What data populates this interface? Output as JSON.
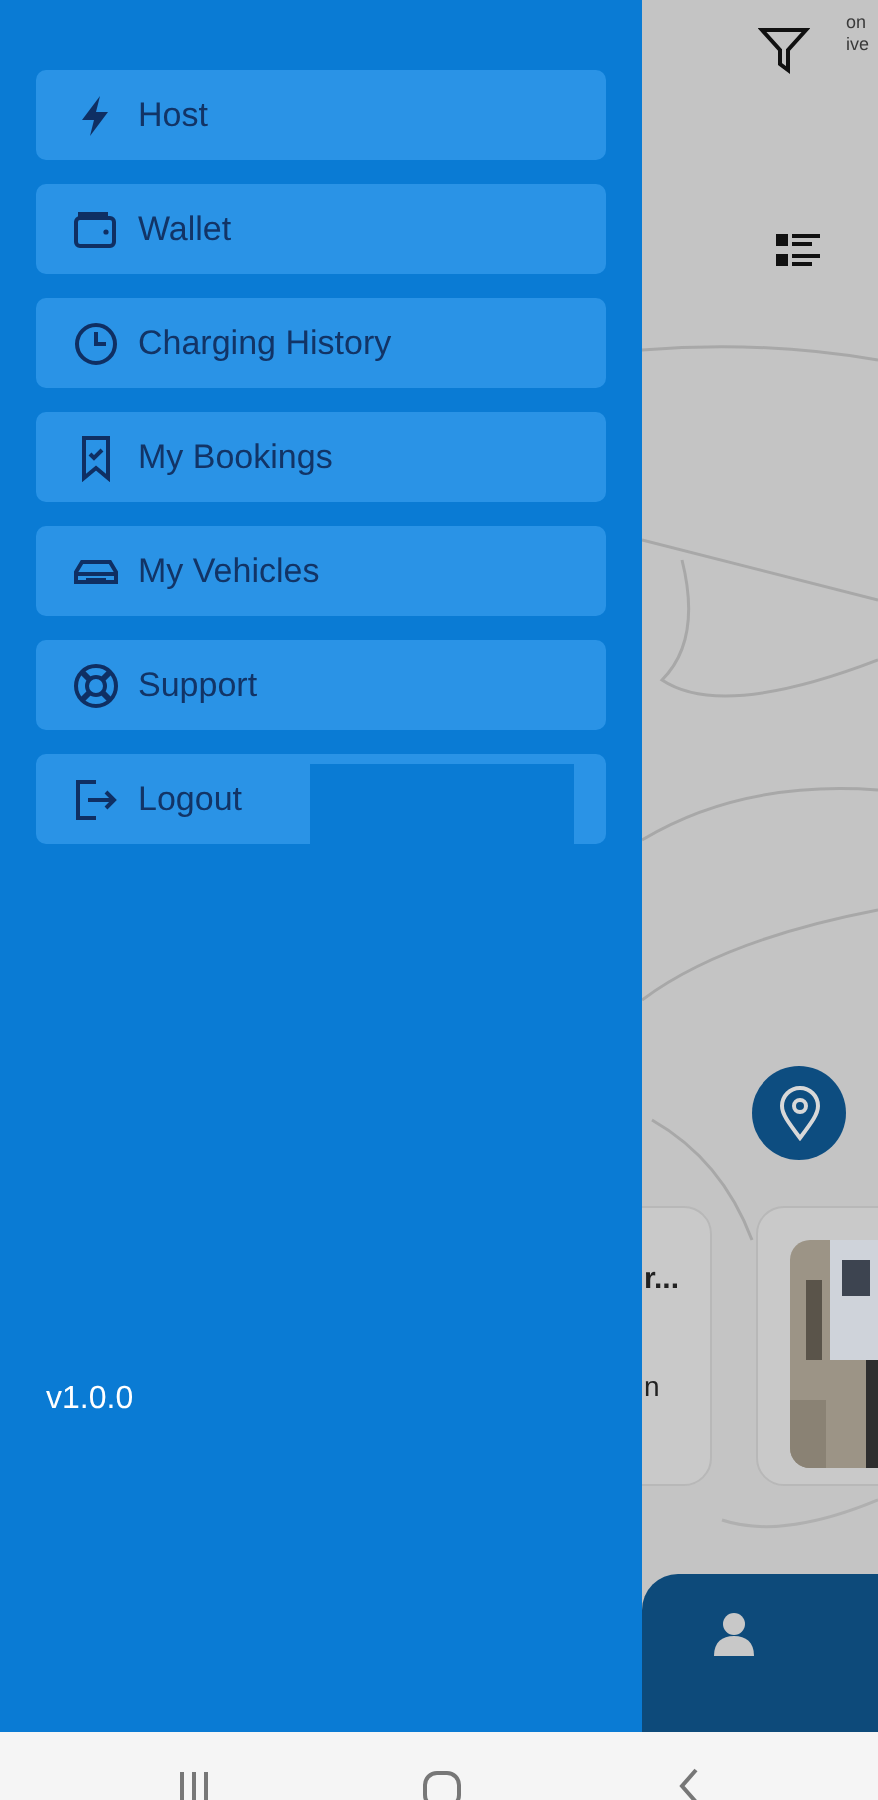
{
  "drawer": {
    "menu": [
      {
        "kind": "bolt",
        "label": "Host"
      },
      {
        "kind": "wallet",
        "label": "Wallet"
      },
      {
        "kind": "clock",
        "label": "Charging History"
      },
      {
        "kind": "bookmark",
        "label": "My Bookings"
      },
      {
        "kind": "car",
        "label": "My Vehicles"
      },
      {
        "kind": "lifebuoy",
        "label": "Support"
      },
      {
        "kind": "logout",
        "label": "Logout"
      }
    ],
    "version": "v1.0.0"
  },
  "background": {
    "header_text": [
      "on",
      "ive"
    ],
    "cards": [
      {
        "title": "r...",
        "subtitle": "n"
      },
      {
        "kind": "picture"
      }
    ]
  }
}
